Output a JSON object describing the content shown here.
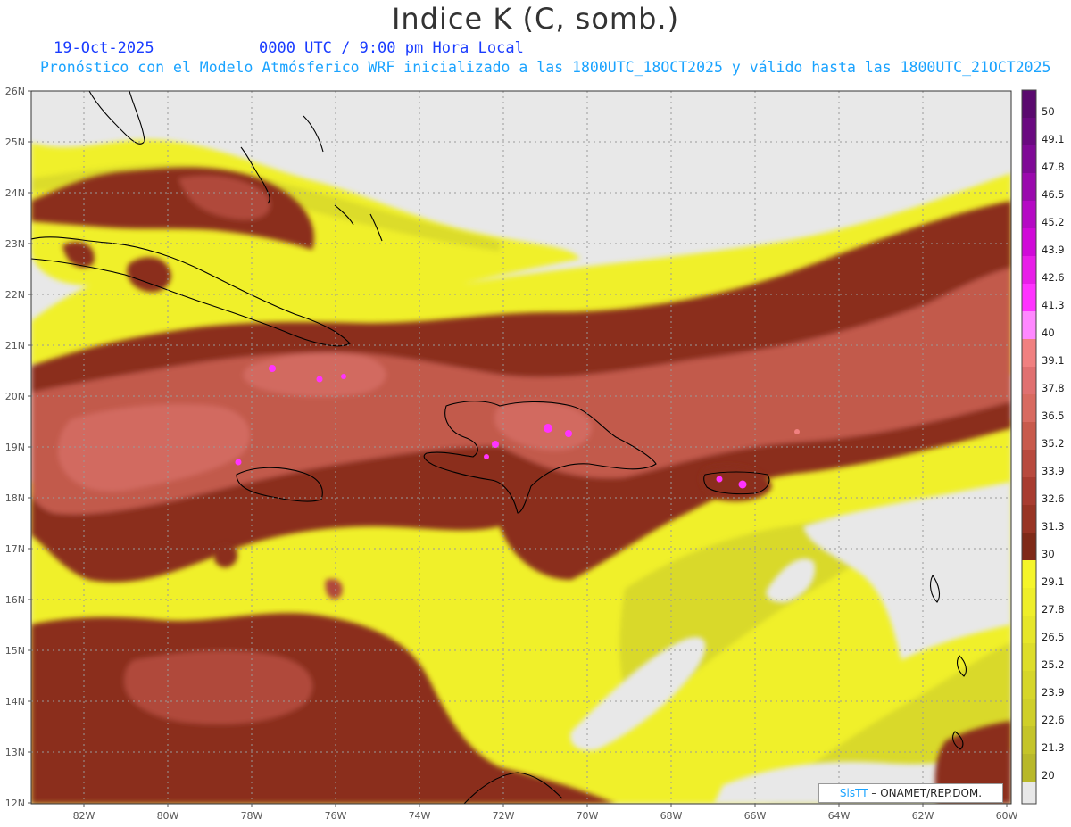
{
  "header": {
    "title": "Indice K (C, somb.)",
    "date": "19-Oct-2025",
    "time": "0000 UTC / 9:00 pm Hora Local",
    "description": "Pronóstico con el Modelo Atmósferico WRF inicializado a las 1800UTC_18OCT2025 y válido hasta las  1800UTC_21OCT2025"
  },
  "map": {
    "lon_labels": [
      "82W",
      "80W",
      "78W",
      "76W",
      "74W",
      "72W",
      "70W",
      "68W",
      "66W",
      "64W",
      "62W",
      "60W"
    ],
    "lat_labels": [
      "26N",
      "25N",
      "24N",
      "23N",
      "22N",
      "21N",
      "20N",
      "19N",
      "18N",
      "17N",
      "16N",
      "15N",
      "14N",
      "13N",
      "12N"
    ],
    "grid": "dotted",
    "colors": {
      "ocean_low": "#e8e8e8",
      "yellow": "#f5f52a",
      "olive": "#cfcf2a",
      "brown_dark": "#8b2f1c",
      "brown_mid": "#b04a3a",
      "salmon": "#d26a60",
      "magenta": "#ff33ff"
    }
  },
  "colorbar": {
    "labels": [
      "50",
      "49.1",
      "47.8",
      "46.5",
      "45.2",
      "43.9",
      "42.6",
      "41.3",
      "40",
      "39.1",
      "37.8",
      "36.5",
      "35.2",
      "33.9",
      "32.6",
      "31.3",
      "30",
      "29.1",
      "27.8",
      "26.5",
      "25.2",
      "23.9",
      "22.6",
      "21.3",
      "20"
    ],
    "colors": [
      "#5a0a6e",
      "#6a0a80",
      "#7f0a96",
      "#9a0aad",
      "#b50ac4",
      "#d00ad8",
      "#e81ee8",
      "#ff33ff",
      "#ff88ff",
      "#f08080",
      "#e07070",
      "#d86a60",
      "#c85a4c",
      "#b84a3e",
      "#a83c30",
      "#983424",
      "#7f2a18",
      "#f5f52a",
      "#eeee2a",
      "#e6e62a",
      "#dddd2a",
      "#d6d62a",
      "#cfcf2a",
      "#c4c42a",
      "#b8b82a"
    ]
  },
  "credit": {
    "brand": "SisTT",
    "text": "– ONAMET/REP.DOM."
  }
}
